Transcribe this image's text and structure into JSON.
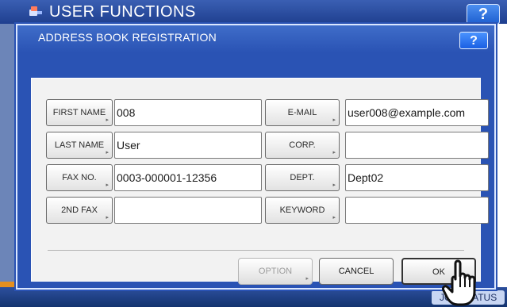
{
  "background_app": {
    "title": "USER FUNCTIONS",
    "help_label": "?",
    "job_status_label": "JOB STATUS"
  },
  "dialog": {
    "title": "ADDRESS BOOK REGISTRATION",
    "help_label": "?",
    "fields_left": [
      {
        "label": "FIRST NAME",
        "value": "008"
      },
      {
        "label": "LAST NAME",
        "value": "User"
      },
      {
        "label": "FAX NO.",
        "value": "0003-000001-12356"
      },
      {
        "label": "2ND FAX",
        "value": ""
      }
    ],
    "fields_right": [
      {
        "label": "E-MAIL",
        "value": "user008@example.com"
      },
      {
        "label": "CORP.",
        "value": ""
      },
      {
        "label": "DEPT.",
        "value": "Dept02"
      },
      {
        "label": "KEYWORD",
        "value": ""
      }
    ],
    "buttons": {
      "option": "OPTION",
      "cancel": "CANCEL",
      "ok": "OK"
    },
    "corner_marker": "▸",
    "option_enabled": false
  },
  "colors": {
    "dialog_blue": "#2a53b4",
    "panel_gray": "#f2f2f2",
    "help_button_blue": "#1a5fe3",
    "accent_orange": "#e58f1f"
  },
  "icons": {
    "app_logo": "toner-logo-icon",
    "pointer": "hand-pointer-icon"
  }
}
